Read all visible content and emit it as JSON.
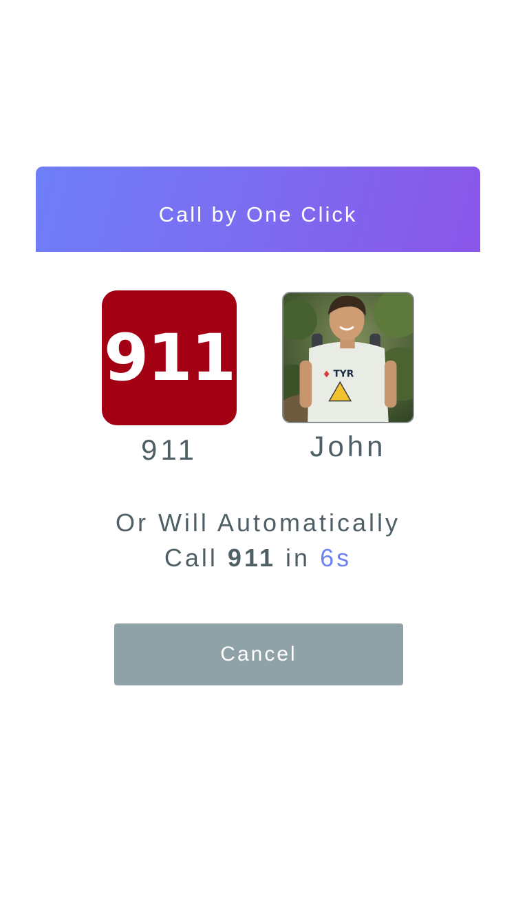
{
  "dialog": {
    "title": "Call by One Click"
  },
  "contacts": [
    {
      "name": "911",
      "tile_text": "911",
      "tile_color": "#a30013",
      "icon": "emergency-911-icon"
    },
    {
      "name": "John",
      "avatar": "john-avatar-photo"
    }
  ],
  "countdown": {
    "line1": "Or Will Automatically",
    "prefix": "Call",
    "number": "911",
    "middle": "in",
    "seconds": "6s",
    "seconds_color": "#6b82f0"
  },
  "cancel_button": {
    "label": "Cancel"
  },
  "colors": {
    "header_gradient_start": "#6e7ef9",
    "header_gradient_end": "#8a56e9",
    "text": "#4f5f66",
    "cancel_bg": "#8fa2a8"
  }
}
